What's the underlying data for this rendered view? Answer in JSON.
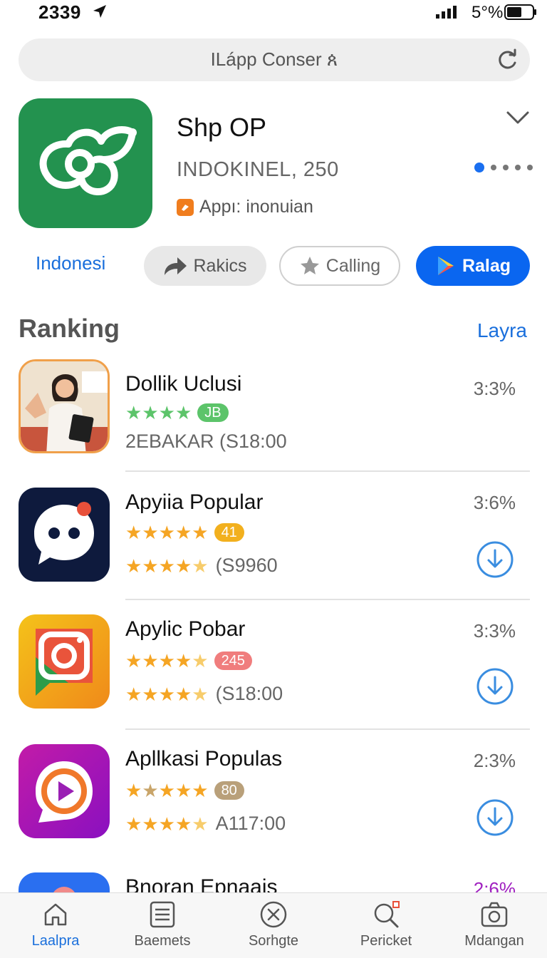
{
  "status_bar": {
    "time": "2339",
    "battery_text": "5°%"
  },
  "search": {
    "placeholder": "ILápp Conser ጰ"
  },
  "app": {
    "title": "Shp OP",
    "subtitle": "INDOKINEL, 250",
    "meta": "Appı: inonuian",
    "icon_color": "#23924f"
  },
  "actions": {
    "language": "Indonesi",
    "rakics": "Rakics",
    "calling": "Calling",
    "ralag": "Ralag"
  },
  "ranking": {
    "title": "Ranking",
    "link": "Layra",
    "items": [
      {
        "name": "Dollik Uclusi",
        "badge": "JB",
        "badge_color": "#5cc46a",
        "meta": "2EBAKAR  (S18:00",
        "percent": "3:3%"
      },
      {
        "name": "Apyiia Popular",
        "badge": "41",
        "badge_color": "#f2b01e",
        "meta": "(S9960",
        "percent": "3:6%"
      },
      {
        "name": "Apylic Pobar",
        "badge": "245",
        "badge_color": "#f07d7d",
        "meta": "(S18:00",
        "percent": "3:3%"
      },
      {
        "name": "Apllkasi Populas",
        "badge": "80",
        "badge_color": "#b9a07a",
        "meta": "A117:00",
        "percent": "2:3%"
      },
      {
        "name": "Bnoran Epnaais",
        "percent": "2:6%"
      }
    ]
  },
  "tabs": [
    {
      "label": "Laalpra",
      "icon": "home-icon"
    },
    {
      "label": "Baemets",
      "icon": "list-icon"
    },
    {
      "label": "Sorhgte",
      "icon": "close-circle-icon"
    },
    {
      "label": "Pericket",
      "icon": "search-icon"
    },
    {
      "label": "Mdangan",
      "icon": "camera-icon"
    }
  ],
  "colors": {
    "accent": "#1a6fdc",
    "primary_button": "#0a66f0",
    "star_green": "#5cc46a",
    "star_gold": "#f5a524"
  }
}
